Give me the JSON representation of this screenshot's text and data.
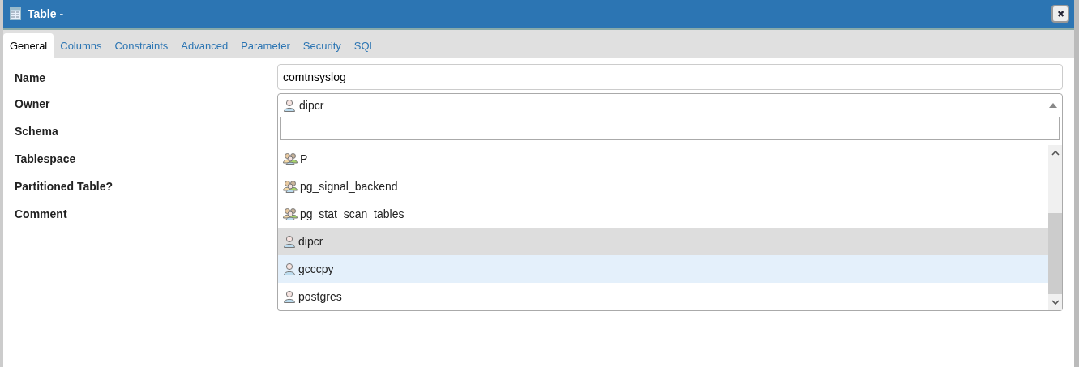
{
  "window": {
    "title": "Table -",
    "close": "✖"
  },
  "tabs": [
    {
      "label": "General",
      "selected": true
    },
    {
      "label": "Columns",
      "selected": false
    },
    {
      "label": "Constraints",
      "selected": false
    },
    {
      "label": "Advanced",
      "selected": false
    },
    {
      "label": "Parameter",
      "selected": false
    },
    {
      "label": "Security",
      "selected": false
    },
    {
      "label": "SQL",
      "selected": false
    }
  ],
  "form": {
    "labels": [
      "Name",
      "Owner",
      "Schema",
      "Tablespace",
      "Partitioned Table?",
      "Comment"
    ],
    "name_value": "comtnsyslog",
    "owner": {
      "value": "dipcr",
      "open": true,
      "options": [
        {
          "name": "P",
          "kind": "group",
          "selected": false,
          "hovered": false
        },
        {
          "name": "pg_signal_backend",
          "kind": "group",
          "selected": false,
          "hovered": false
        },
        {
          "name": "pg_stat_scan_tables",
          "kind": "group",
          "selected": false,
          "hovered": false
        },
        {
          "name": "dipcr",
          "kind": "user",
          "selected": true,
          "hovered": false
        },
        {
          "name": "gcccpy",
          "kind": "user",
          "selected": false,
          "hovered": true
        },
        {
          "name": "postgres",
          "kind": "user",
          "selected": false,
          "hovered": false
        }
      ]
    }
  }
}
